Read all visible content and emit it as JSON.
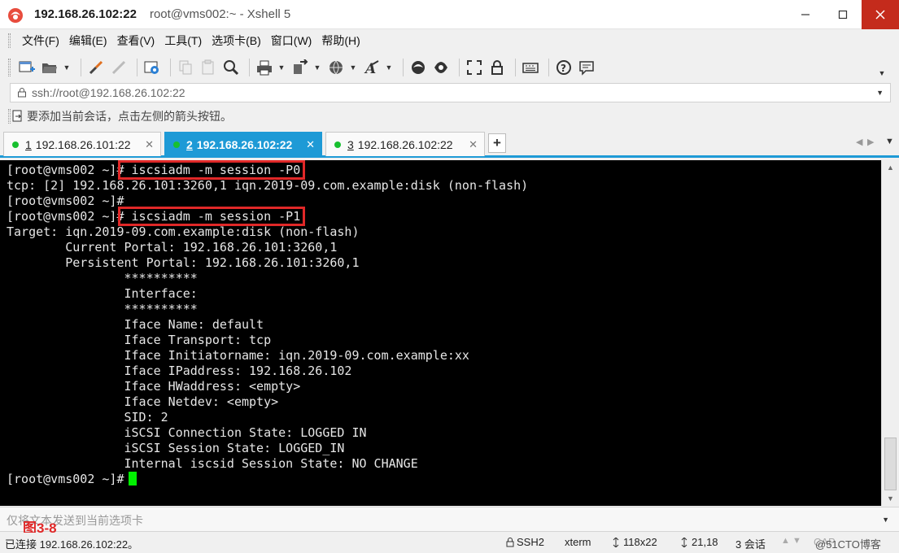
{
  "window": {
    "title_host": "192.168.26.102:22",
    "title_sub": "root@vms002:~ - Xshell 5"
  },
  "menu": {
    "items": [
      "文件(F)",
      "编辑(E)",
      "查看(V)",
      "工具(T)",
      "选项卡(B)",
      "窗口(W)",
      "帮助(H)"
    ]
  },
  "address": {
    "value": "ssh://root@192.168.26.102:22"
  },
  "hint": {
    "text": "要添加当前会话，点击左侧的箭头按钮。"
  },
  "tabs": [
    {
      "num": "1",
      "label": "192.168.26.101:22",
      "active": false
    },
    {
      "num": "2",
      "label": "192.168.26.102:22",
      "active": true
    },
    {
      "num": "3",
      "label": "192.168.26.102:22",
      "active": false
    }
  ],
  "terminal": {
    "lines": [
      "[root@vms002 ~]# iscsiadm -m session -P0",
      "tcp: [2] 192.168.26.101:3260,1 iqn.2019-09.com.example:disk (non-flash)",
      "[root@vms002 ~]#",
      "[root@vms002 ~]# iscsiadm -m session -P1",
      "Target: iqn.2019-09.com.example:disk (non-flash)",
      "        Current Portal: 192.168.26.101:3260,1",
      "        Persistent Portal: 192.168.26.101:3260,1",
      "                **********",
      "                Interface:",
      "                **********",
      "                Iface Name: default",
      "                Iface Transport: tcp",
      "                Iface Initiatorname: iqn.2019-09.com.example:xx",
      "                Iface IPaddress: 192.168.26.102",
      "                Iface HWaddress: <empty>",
      "                Iface Netdev: <empty>",
      "                SID: 2",
      "                iSCSI Connection State: LOGGED IN",
      "                iSCSI Session State: LOGGED_IN",
      "                Internal iscsid Session State: NO CHANGE",
      "[root@vms002 ~]#"
    ]
  },
  "compose": {
    "placeholder": "仅将文本发送到当前选项卡"
  },
  "figure_label": "图3-8",
  "status": {
    "connection": "已连接 192.168.26.102:22。",
    "protocol": "SSH2",
    "terminal_type": "xterm",
    "size": "118x22",
    "cursor_pos": "21,18",
    "sessions": "3 会话",
    "caps": "CAP",
    "watermark": "@51CTO博客"
  },
  "colors": {
    "tab_active": "#1e9ad6",
    "highlight": "#e02828",
    "cursor": "#00f000",
    "status_dot": "#18c030"
  }
}
